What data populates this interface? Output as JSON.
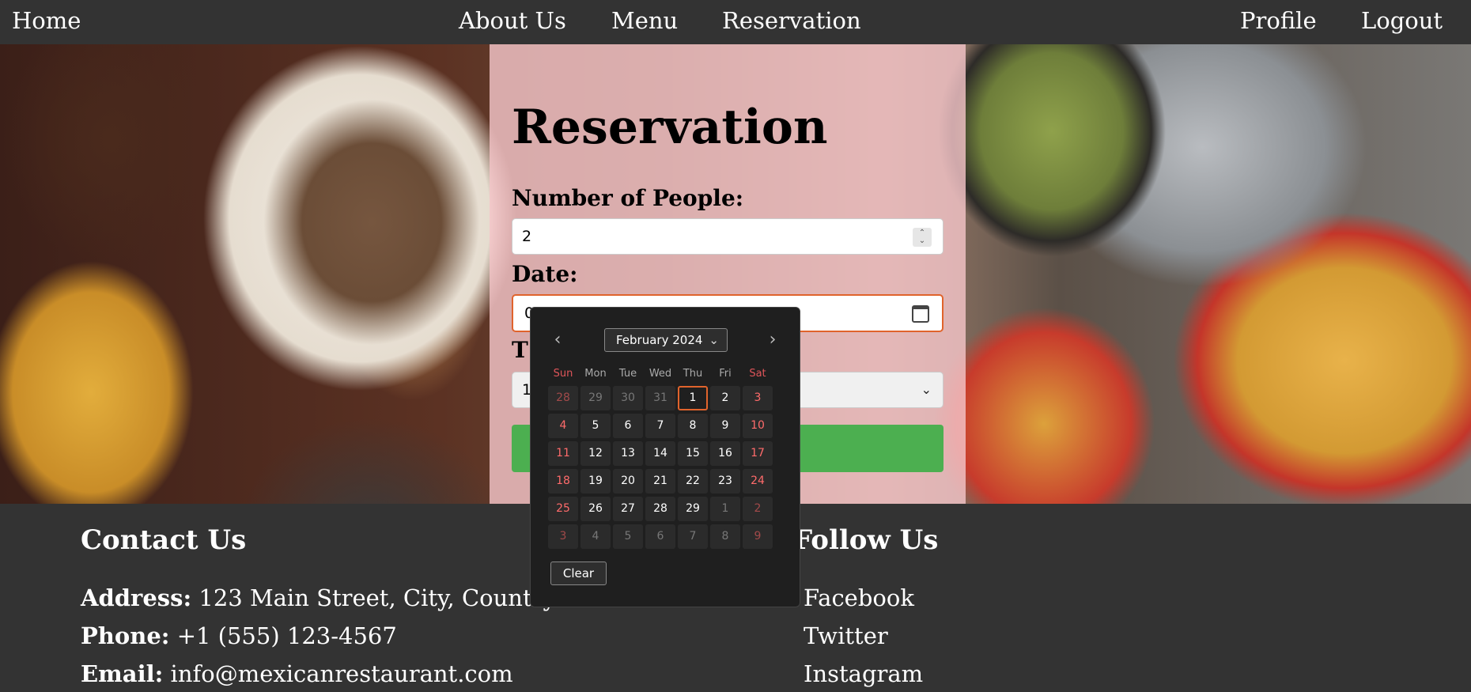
{
  "nav": {
    "home": "Home",
    "about": "About Us",
    "menu": "Menu",
    "reservation": "Reservation",
    "profile": "Profile",
    "logout": "Logout"
  },
  "form": {
    "title": "Reservation",
    "people_label": "Number of People:",
    "people_value": "2",
    "date_label": "Date:",
    "date_value": "0",
    "time_label": "T",
    "time_value": "1"
  },
  "datepicker": {
    "month_label": "February 2024",
    "weekdays": [
      "Sun",
      "Mon",
      "Tue",
      "Wed",
      "Thu",
      "Fri",
      "Sat"
    ],
    "weeks": [
      [
        "28",
        "29",
        "30",
        "31",
        "1",
        "2",
        "3"
      ],
      [
        "4",
        "5",
        "6",
        "7",
        "8",
        "9",
        "10"
      ],
      [
        "11",
        "12",
        "13",
        "14",
        "15",
        "16",
        "17"
      ],
      [
        "18",
        "19",
        "20",
        "21",
        "22",
        "23",
        "24"
      ],
      [
        "25",
        "26",
        "27",
        "28",
        "29",
        "1",
        "2"
      ],
      [
        "3",
        "4",
        "5",
        "6",
        "7",
        "8",
        "9"
      ]
    ],
    "today": "1",
    "clear_label": "Clear"
  },
  "footer": {
    "contact_heading": "Contact Us",
    "address_label": "Address:",
    "address_value": " 123 Main Street, City, Country",
    "phone_label": "Phone:",
    "phone_value": " +1 (555) 123-4567",
    "email_label": "Email:",
    "email_value": " info@mexicanrestaurant.com",
    "follow_heading": "Follow Us",
    "social": [
      "Facebook",
      "Twitter",
      "Instagram"
    ]
  },
  "colors": {
    "nav_bg": "#333333",
    "card_bg": "#f4c4c8",
    "accent_orange": "#e0632c",
    "submit_green": "#4caf50",
    "weekend_red": "#ff6b6b"
  }
}
